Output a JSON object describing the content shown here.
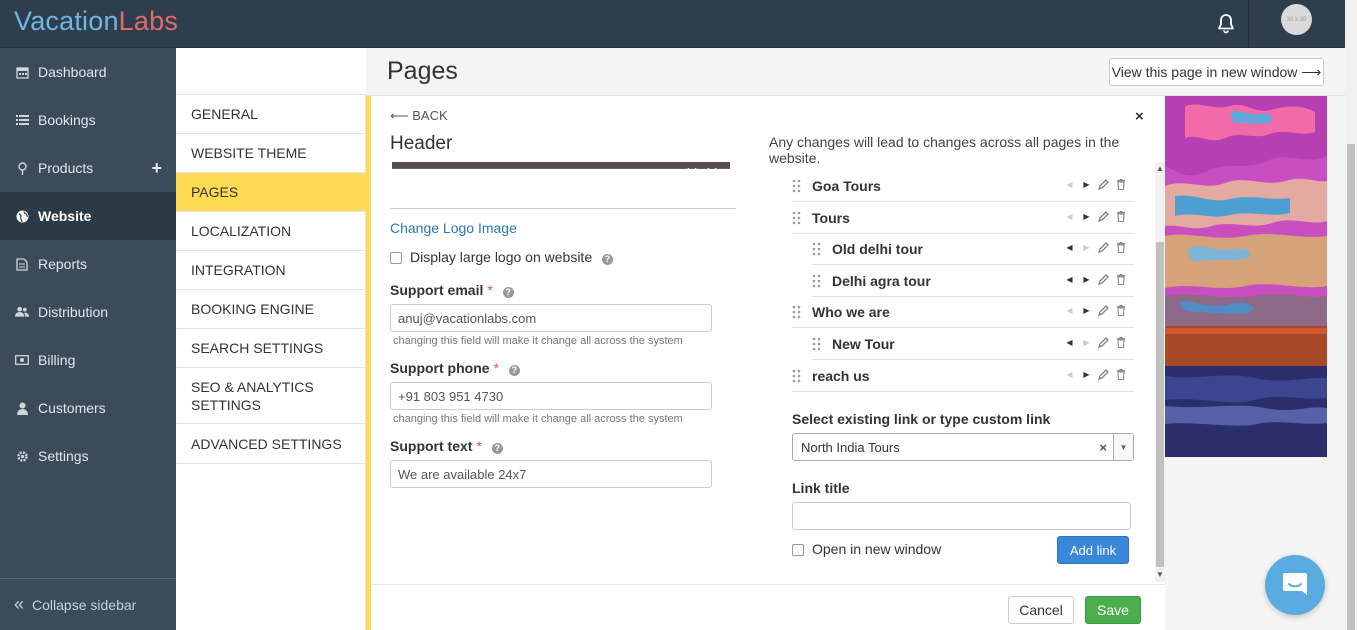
{
  "topbar": {
    "logo_part1": "Vacation",
    "logo_part2": "Labs",
    "avatar_text": "30 x 30"
  },
  "sidebar": {
    "items": [
      {
        "label": "Dashboard",
        "icon": "calendar-icon"
      },
      {
        "label": "Bookings",
        "icon": "list-icon"
      },
      {
        "label": "Products",
        "icon": "map-pin-icon"
      },
      {
        "label": "Website",
        "icon": "globe-icon"
      },
      {
        "label": "Reports",
        "icon": "report-icon"
      },
      {
        "label": "Distribution",
        "icon": "users-icon"
      },
      {
        "label": "Billing",
        "icon": "money-icon"
      },
      {
        "label": "Customers",
        "icon": "user-icon"
      },
      {
        "label": "Settings",
        "icon": "gear-icon"
      }
    ],
    "add_symbol": "+",
    "collapse_label": "Collapse sidebar"
  },
  "submenu": {
    "items": [
      "GENERAL",
      "WEBSITE THEME",
      "PAGES",
      "LOCALIZATION",
      "INTEGRATION",
      "BOOKING ENGINE",
      "SEARCH SETTINGS",
      "SEO & ANALYTICS SETTINGS",
      "ADVANCED SETTINGS"
    ]
  },
  "page": {
    "title": "Pages",
    "view_button": "View this page in new window ⟶"
  },
  "panel": {
    "back": "⟵ BACK",
    "close": "×",
    "title": "Header",
    "note": "Any changes will lead to changes across all pages in the website.",
    "change_logo": "Change Logo Image",
    "large_logo_label": "Display large logo on website",
    "support_email_label": "Support email",
    "support_email_value": "anuj@vacationlabs.com",
    "support_phone_label": "Support phone",
    "support_phone_value": "+91 803 951 4730",
    "support_text_label": "Support text",
    "support_text_value": "We are available 24x7",
    "hint": "changing this field will make it change all across the system",
    "required_mark": "*",
    "help_mark": "?"
  },
  "menu": {
    "items": [
      {
        "label": "Goa Tours",
        "indent": false
      },
      {
        "label": "Tours",
        "indent": false
      },
      {
        "label": "Old delhi tour",
        "indent": true
      },
      {
        "label": "Delhi agra tour",
        "indent": true
      },
      {
        "label": "Who we are",
        "indent": false
      },
      {
        "label": "New Tour",
        "indent": true
      },
      {
        "label": "reach us",
        "indent": false
      }
    ],
    "select_label": "Select existing link or type custom link",
    "select_value": "North India Tours",
    "link_title_label": "Link title",
    "link_title_value": "",
    "new_window_label": "Open in new window",
    "add_link": "Add link"
  },
  "footer": {
    "cancel": "Cancel",
    "save": "Save"
  },
  "colors": {
    "topbar": "#2f3e4c",
    "sidebar": "#3b4b59",
    "accent_yellow": "#ffda55",
    "link_blue": "#2a7ab0",
    "add_button": "#3a86d8",
    "save_button": "#4cae4c"
  }
}
